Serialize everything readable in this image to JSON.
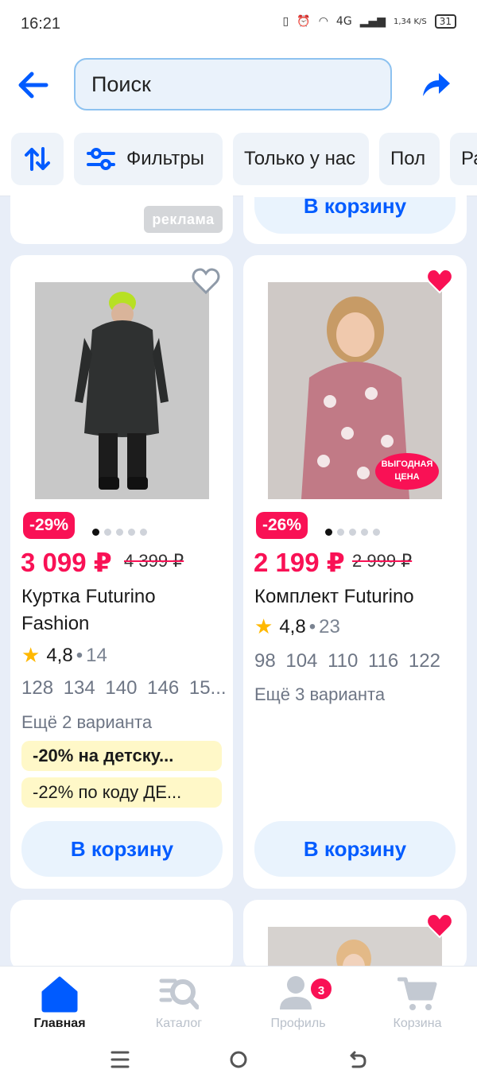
{
  "status_bar": {
    "time": "16:21",
    "network": "4G",
    "speed": "1,34 K/S",
    "battery": "31"
  },
  "header": {
    "search_placeholder": "Поиск"
  },
  "filters": {
    "chips": [
      "Фильтры",
      "Только у нас",
      "Пол",
      "Ра"
    ]
  },
  "previous_row": {
    "ad_label": "реклама",
    "cart_label": "В корзину"
  },
  "products": [
    {
      "discount": "-29%",
      "price": "3 099 ₽",
      "old_price": "4 399 ₽",
      "title_line1": "Куртка Futurino",
      "title_line2": "Fashion",
      "rating": "4,8",
      "reviews": "14",
      "sizes": "128 134 140 146 15...",
      "more_variants": "Ещё 2 варианта",
      "promo1": "-20% на детску...",
      "promo2": "-22% по коду ДЕ...",
      "cart_label": "В корзину",
      "favorited": false
    },
    {
      "discount": "-26%",
      "price": "2 199 ₽",
      "old_price": "2 999 ₽",
      "title_line1": "Комплект Futurino",
      "rating": "4,8",
      "reviews": "23",
      "sizes": "98 104 110 116 122",
      "more_variants": "Ещё 3 варианта",
      "badge_line1": "ВЫГОДНАЯ",
      "badge_line2": "ЦЕНА",
      "cart_label": "В корзину",
      "favorited": true
    }
  ],
  "bottom_nav": {
    "home": "Главная",
    "catalog": "Каталог",
    "profile": "Профиль",
    "profile_badge": "3",
    "cart": "Корзина"
  },
  "colors": {
    "accent": "#005bff",
    "sale": "#f91155",
    "promo_bg": "#fff8c8"
  }
}
